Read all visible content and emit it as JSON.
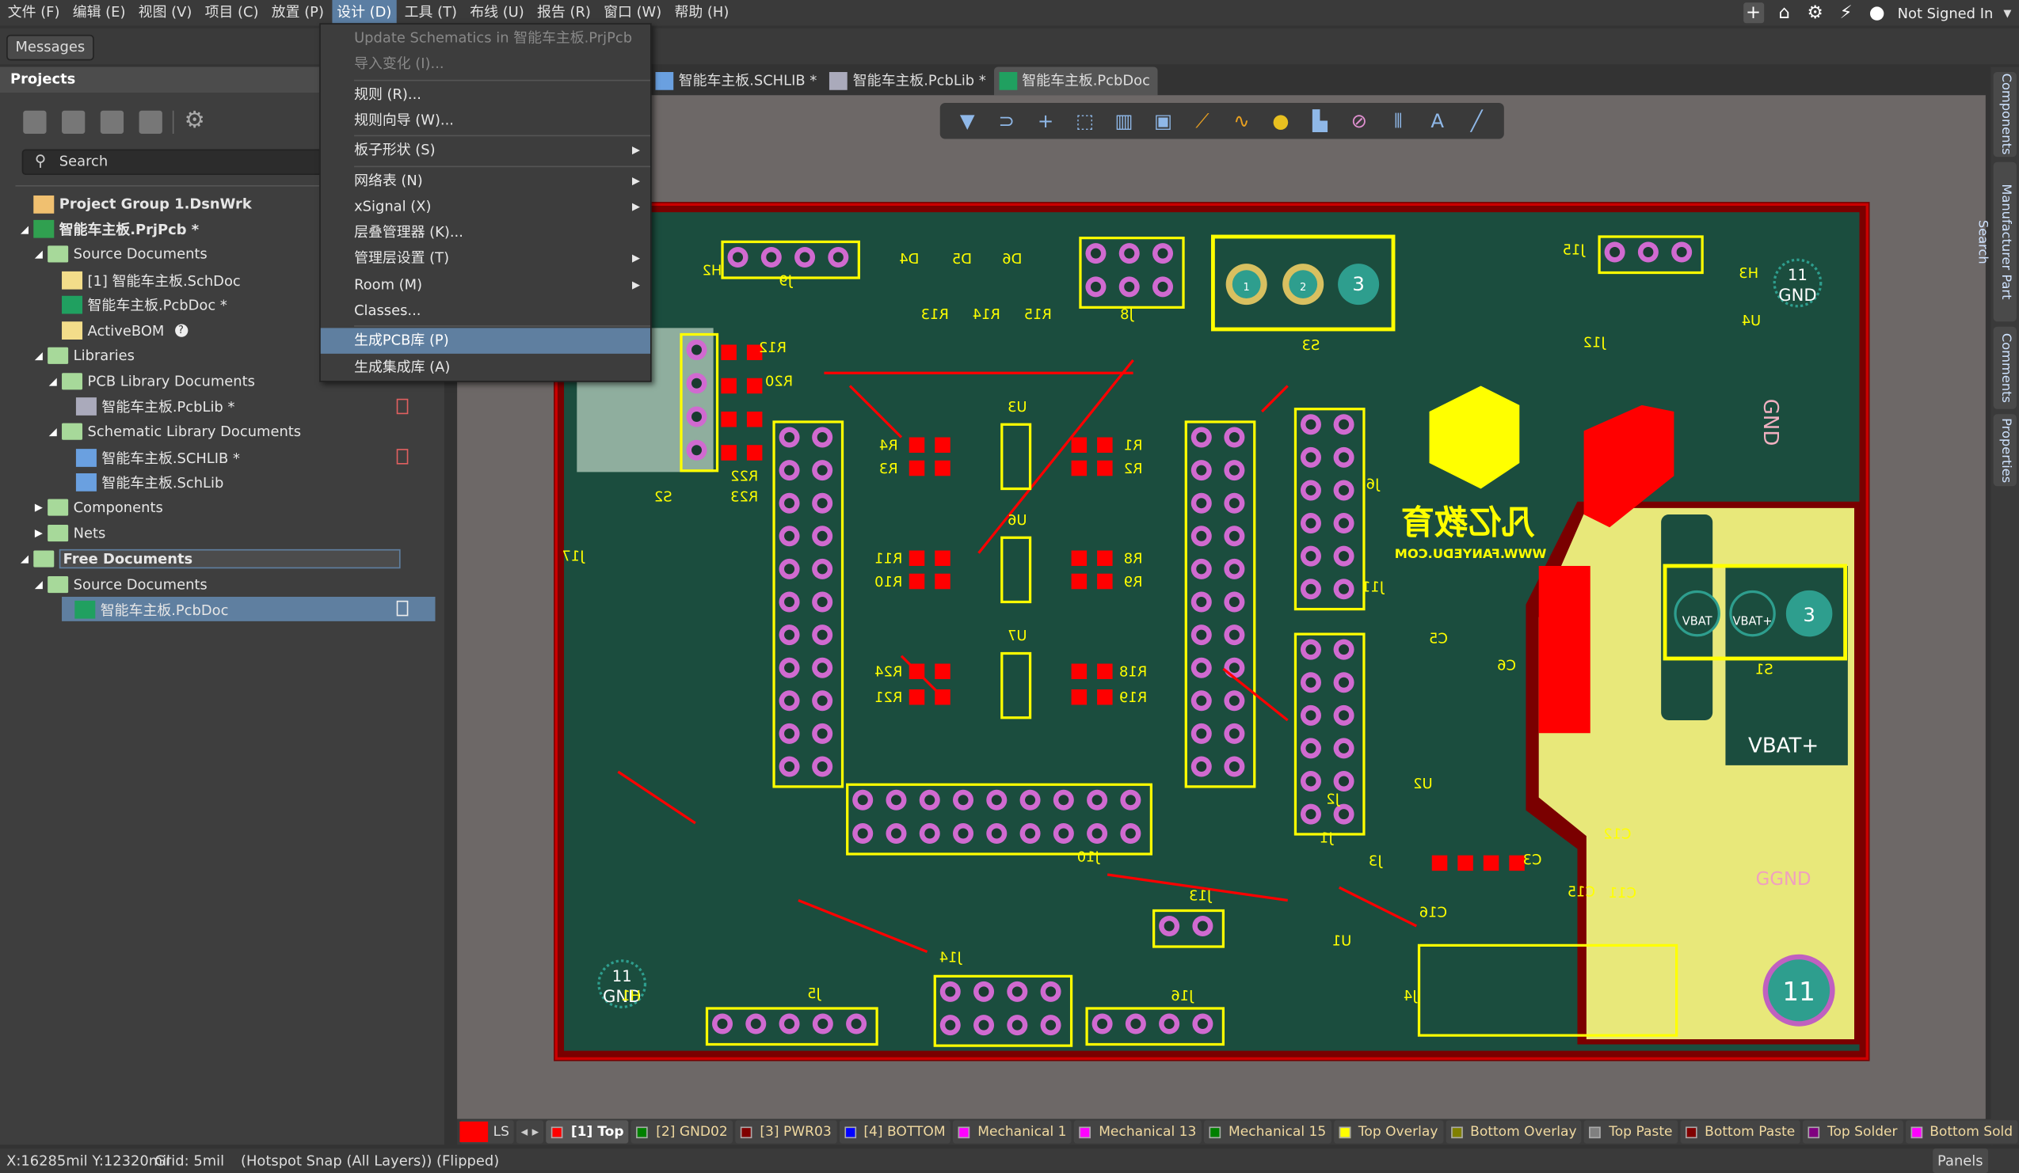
{
  "menubar": {
    "items": [
      "文件 (F)",
      "编辑 (E)",
      "视图 (V)",
      "项目 (C)",
      "放置 (P)",
      "设计 (D)",
      "工具 (T)",
      "布线 (U)",
      "报告 (R)",
      "窗口 (W)",
      "帮助 (H)"
    ],
    "active_index": 5,
    "user": "Not Signed In"
  },
  "messages_label": "Messages",
  "projects": {
    "title": "Projects",
    "search_placeholder": "Search",
    "tree": [
      {
        "label": "Project Group 1.DsnWrk",
        "level": 0,
        "type": "group",
        "bold": true
      },
      {
        "label": "智能车主板.PrjPcb *",
        "level": 0,
        "type": "prj",
        "bold": true,
        "expanded": true
      },
      {
        "label": "Source Documents",
        "level": 1,
        "type": "folder",
        "expanded": true
      },
      {
        "label": "[1] 智能车主板.SchDoc",
        "level": 2,
        "type": "sch"
      },
      {
        "label": "智能车主板.PcbDoc *",
        "level": 2,
        "type": "pcb"
      },
      {
        "label": "ActiveBOM",
        "level": 2,
        "type": "bom",
        "help": "?"
      },
      {
        "label": "Libraries",
        "level": 1,
        "type": "folder",
        "expanded": true
      },
      {
        "label": "PCB Library Documents",
        "level": 2,
        "type": "folder",
        "expanded": true
      },
      {
        "label": "智能车主板.PcbLib *",
        "level": 3,
        "type": "pcblib",
        "doc_status": "red"
      },
      {
        "label": "Schematic Library Documents",
        "level": 2,
        "type": "folder",
        "expanded": true
      },
      {
        "label": "智能车主板.SCHLIB *",
        "level": 3,
        "type": "schlib",
        "doc_status": "red"
      },
      {
        "label": "智能车主板.SchLib",
        "level": 3,
        "type": "schlib"
      },
      {
        "label": "Components",
        "level": 1,
        "type": "folder",
        "expanded": false
      },
      {
        "label": "Nets",
        "level": 1,
        "type": "folder",
        "expanded": false
      },
      {
        "label": "Free Documents",
        "level": 0,
        "type": "folder",
        "expanded": true,
        "bold": true,
        "focused": true
      },
      {
        "label": "Source Documents",
        "level": 1,
        "type": "folder",
        "expanded": true
      },
      {
        "label": "智能车主板.PcbDoc",
        "level": 2,
        "type": "pcb",
        "selected": true,
        "doc_status": "white"
      }
    ]
  },
  "design_menu": [
    {
      "label": "Update Schematics in 智能车主板.PrjPcb",
      "disabled": true
    },
    {
      "label": "导入变化 (I)...",
      "disabled": true,
      "sep_after": true
    },
    {
      "label": "规则 (R)..."
    },
    {
      "label": "规则向导 (W)...",
      "sep_after": true
    },
    {
      "label": "板子形状 (S)",
      "submenu": true,
      "sep_after": true
    },
    {
      "label": "网络表 (N)",
      "submenu": true
    },
    {
      "label": "xSignal (X)",
      "submenu": true
    },
    {
      "label": "层叠管理器 (K)..."
    },
    {
      "label": "管理层设置 (T)",
      "submenu": true
    },
    {
      "label": "Room (M)",
      "submenu": true
    },
    {
      "label": "Classes...",
      "sep_after": true
    },
    {
      "label": "生成PCB库 (P)",
      "highlighted": true
    },
    {
      "label": "生成集成库 (A)"
    }
  ],
  "doc_tabs": [
    {
      "label": "智能车主板.SCHLIB *"
    },
    {
      "label": "智能车主板.PcbLib *"
    },
    {
      "label": "智能车主板.PcbDoc",
      "active": true
    }
  ],
  "pcb_toolbar": [
    "filter-icon",
    "interactive-route-icon",
    "cross-icon",
    "select-rect-icon",
    "align-icon",
    "component-icon",
    "route-icon",
    "diff-pair-icon",
    "via-icon",
    "fill-icon",
    "polygon-icon",
    "dimension-icon",
    "text-icon",
    "line-icon"
  ],
  "right_panels": [
    "Components",
    "Manufacturer Part Search",
    "Comments",
    "Properties"
  ],
  "layers": {
    "ls_label": "LS",
    "items": [
      {
        "label": "[1] Top",
        "color": "#ff0000",
        "active": true
      },
      {
        "label": "[2] GND02",
        "color": "#008000"
      },
      {
        "label": "[3] PWR03",
        "color": "#800000"
      },
      {
        "label": "[4] BOTTOM",
        "color": "#0000ff"
      },
      {
        "label": "Mechanical 1",
        "color": "#ff00ff"
      },
      {
        "label": "Mechanical 13",
        "color": "#ff00ff"
      },
      {
        "label": "Mechanical 15",
        "color": "#008000"
      },
      {
        "label": "Top Overlay",
        "color": "#ffff00"
      },
      {
        "label": "Bottom Overlay",
        "color": "#808000"
      },
      {
        "label": "Top Paste",
        "color": "#808080"
      },
      {
        "label": "Bottom Paste",
        "color": "#800000"
      },
      {
        "label": "Top Solder",
        "color": "#800080"
      },
      {
        "label": "Bottom Sold",
        "color": "#ff00ff"
      }
    ]
  },
  "status": {
    "coords": "X:16285mil Y:12320mil",
    "grid": "Grid: 5mil",
    "snap": "(Hotspot Snap (All Layers)) (Flipped)",
    "panels": "Panels"
  },
  "board": {
    "colors": {
      "board": "#1b4d3e",
      "outline": "#cc0000",
      "overlay": "#ffff00",
      "copper_top": "#ff0000",
      "pad": "#d06ad0",
      "poly": "#e8e87a"
    },
    "logo_cn": "凡亿教育",
    "logo_url": "WWW.FANYEDU.COM",
    "labels": [
      "J9",
      "J8",
      "S3",
      "J15",
      "H3",
      "U4",
      "R12",
      "R20",
      "R22",
      "R23",
      "S2",
      "U3",
      "U6",
      "U7",
      "R4",
      "R3",
      "R1",
      "R2",
      "R11",
      "R10",
      "R8",
      "R9",
      "R24",
      "R21",
      "R18",
      "R19",
      "J17",
      "J11",
      "J2",
      "J6",
      "J1",
      "J10",
      "J14",
      "J5",
      "J16",
      "J13",
      "J4",
      "H1",
      "H2",
      "D4",
      "D5",
      "D6",
      "R13",
      "R14",
      "R15",
      "S1",
      "C5",
      "C6",
      "U2",
      "C3",
      "C15",
      "C16",
      "U1",
      "C12",
      "J3",
      "J12",
      "C11"
    ],
    "pad_texts": {
      "gnd11": "11",
      "gnd": "GND",
      "vbat": "VBAT",
      "vbatp": "VBAT+",
      "one": "1",
      "two": "2",
      "three": "3",
      "vbatp_big": "VBAT+",
      "ggnd": "GGND",
      "gnd_side": "GND",
      "eleven": "11"
    }
  }
}
